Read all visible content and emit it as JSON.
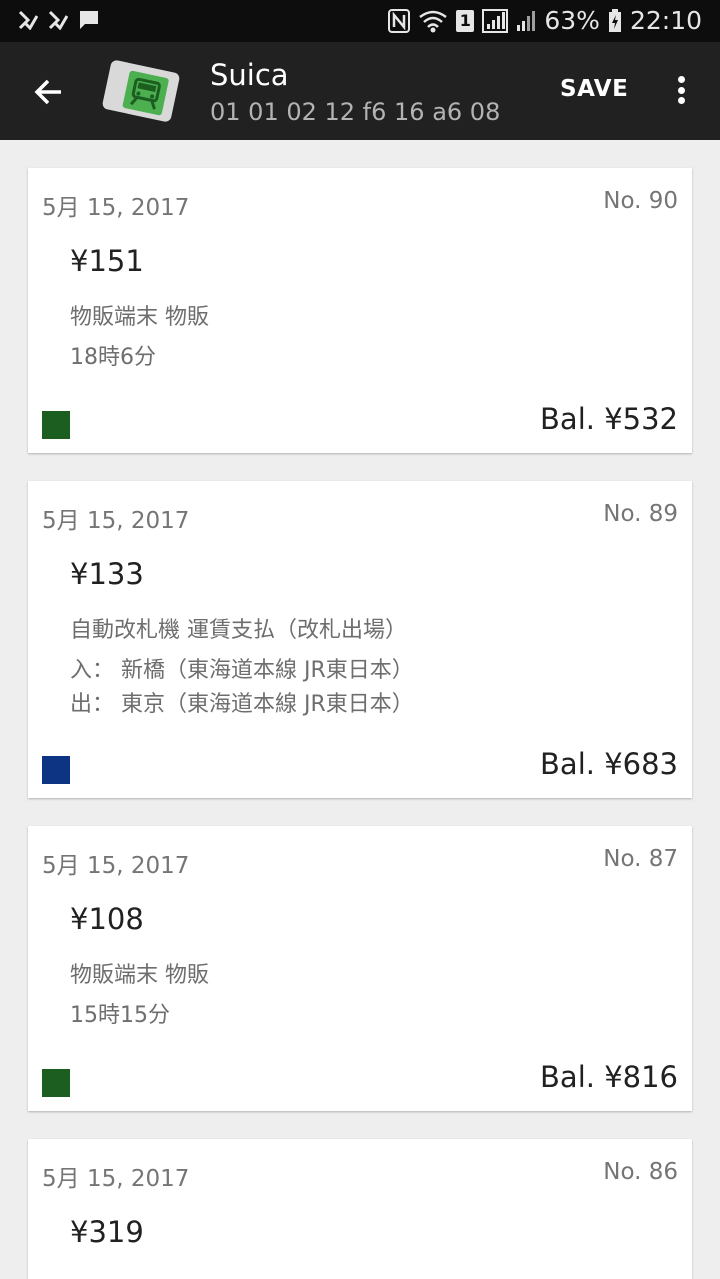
{
  "status_bar": {
    "left_icons": [
      "notification-check-icon",
      "notification-check-icon",
      "message-icon"
    ],
    "battery": "63%",
    "time": "22:10",
    "sim_badge": "1"
  },
  "app_bar": {
    "title": "Suica",
    "card_id": "01 01 02 12 f6 16 a6 08",
    "save_label": "SAVE"
  },
  "colors": {
    "status_bar_bg": "#0d0d0d",
    "app_bar_bg": "#212121",
    "page_bg": "#eeeeee",
    "purchase_swatch": "#1b5e20",
    "transit_swatch": "#0d3483"
  },
  "transactions": [
    {
      "date": "5月 15, 2017",
      "number": "No. 90",
      "amount": "¥151",
      "type": "purchase",
      "lines": [
        "物販端末 物販",
        "18時6分"
      ],
      "balance": "Bal. ¥532"
    },
    {
      "date": "5月 15, 2017",
      "number": "No. 89",
      "amount": "¥133",
      "type": "transit",
      "lines": [
        "自動改札機 運賃支払（改札出場）",
        "入： 新橋（東海道本線 JR東日本）",
        "出： 東京（東海道本線 JR東日本）"
      ],
      "balance": "Bal. ¥683"
    },
    {
      "date": "5月 15, 2017",
      "number": "No. 87",
      "amount": "¥108",
      "type": "purchase",
      "lines": [
        "物販端末 物販",
        "15時15分"
      ],
      "balance": "Bal. ¥816"
    },
    {
      "date": "5月 15, 2017",
      "number": "No. 86",
      "amount": "¥319",
      "type": "unknown",
      "lines": [],
      "balance": ""
    }
  ]
}
